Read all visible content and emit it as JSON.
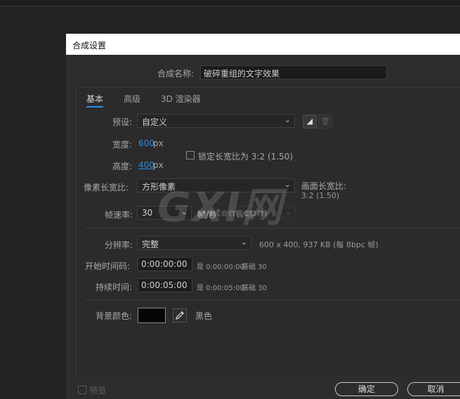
{
  "dialog": {
    "title": "合成设置",
    "name_label": "合成名称:",
    "name_value": "破碎重组的文字效果"
  },
  "tabs": [
    {
      "label": "基本",
      "active": true
    },
    {
      "label": "高级",
      "active": false
    },
    {
      "label": "3D 渲染器",
      "active": false
    }
  ],
  "preset": {
    "label": "预设:",
    "value": "自定义"
  },
  "width": {
    "label": "宽度:",
    "value": "600",
    "unit": "px"
  },
  "height": {
    "label": "高度:",
    "value": "400",
    "unit": "px"
  },
  "lock_aspect": {
    "label": "锁定长宽比为 3:2 (1.50)",
    "checked": false
  },
  "pixel_aspect": {
    "label": "像素长宽比:",
    "value": "方形像素"
  },
  "frame_aspect": {
    "label": "画面长宽比:",
    "value": "3:2 (1.50)"
  },
  "frame_rate": {
    "label": "帧速率:",
    "value": "30",
    "unit": "帧/秒",
    "drop_value": "丢帧"
  },
  "resolution": {
    "label": "分辨率:",
    "value": "完整",
    "info": "600 x 400, 937 KB (每 8bpc 帧)"
  },
  "start_timecode": {
    "label": "开始时间码:",
    "value": "0:00:00:00",
    "equals": "是 0:00:00:00",
    "base": "基础 30"
  },
  "duration": {
    "label": "持续时间:",
    "value": "0:00:05:00",
    "equals": "是 0:00:05:00",
    "base": "基础 30"
  },
  "background": {
    "label": "背景颜色:",
    "color": "#050505",
    "name": "黑色"
  },
  "preview": {
    "label": "预览",
    "checked": false
  },
  "buttons": {
    "ok": "确定",
    "cancel": "取消"
  },
  "watermark": {
    "logo": "GXI网",
    "site": "system.com"
  },
  "colors": {
    "accent": "#2d8ceb",
    "dialog_bg": "#2d2d2d",
    "titlebar": "#ffffff"
  }
}
